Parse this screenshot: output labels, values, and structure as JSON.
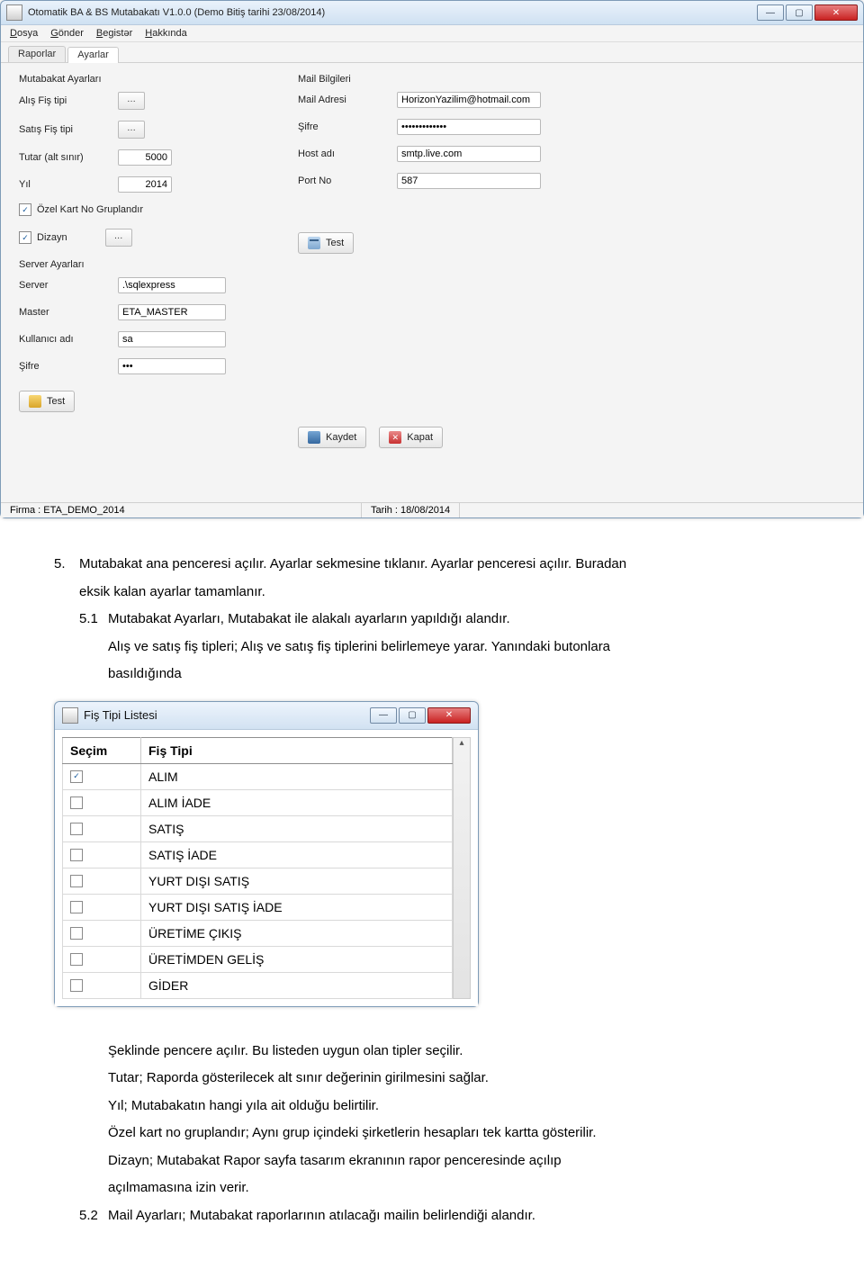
{
  "main_window": {
    "title": "Otomatik BA & BS Mutabakatı V1.0.0 (Demo Bitiş tarihi 23/08/2014)",
    "menu": {
      "dosya": "Dosya",
      "gonder": "Gönder",
      "begistir": "Begistər",
      "hakkinda": "Hakkında"
    },
    "tabs": {
      "raporlar": "Raporlar",
      "ayarlar": "Ayarlar"
    },
    "left": {
      "section": "Mutabakat Ayarları",
      "alis_fis_tipi": "Alış Fiş tipi",
      "satis_fis_tipi": "Satış Fiş tipi",
      "tutar_label": "Tutar (alt sınır)",
      "tutar_value": "5000",
      "yil_label": "Yıl",
      "yil_value": "2014",
      "ozel_kart": "Özel Kart No Gruplandır",
      "dizayn": "Dizayn",
      "server_section": "Server Ayarları",
      "server_label": "Server",
      "server_value": ".\\sqlexpress",
      "master_label": "Master",
      "master_value": "ETA_MASTER",
      "kullanici_label": "Kullanıcı adı",
      "kullanici_value": "sa",
      "sifre_label": "Şifre",
      "sifre_value": "•••",
      "test_btn": "Test"
    },
    "right": {
      "section": "Mail Bilgileri",
      "mail_label": "Mail Adresi",
      "mail_value": "HorizonYazilim@hotmail.com",
      "sifre_label": "Şifre",
      "sifre_value": "•••••••••••••",
      "host_label": "Host adı",
      "host_value": "smtp.live.com",
      "port_label": "Port No",
      "port_value": "587",
      "test_btn": "Test",
      "kaydet_btn": "Kaydet",
      "kapat_btn": "Kapat"
    },
    "status": {
      "firma": "Firma : ETA_DEMO_2014",
      "tarih": "Tarih : 18/08/2014"
    }
  },
  "para5": {
    "num": "5.",
    "line1": "Mutabakat ana penceresi açılır. Ayarlar sekmesine tıklanır. Ayarlar penceresi açılır. Buradan",
    "line2": "eksik kalan ayarlar tamamlanır.",
    "sub1_num": "5.1",
    "sub1_line1": "Mutabakat Ayarları, Mutabakat ile alakalı ayarların yapıldığı alandır.",
    "sub1_line2": "Alış ve satış fiş tipleri; Alış ve satış fiş tiplerini belirlemeye yarar. Yanındaki butonlara",
    "sub1_line3": "basıldığında"
  },
  "dialog": {
    "title": "Fiş Tipi Listesi",
    "col_secim": "Seçim",
    "col_fistipi": "Fiş Tipi",
    "rows": [
      {
        "checked": true,
        "name": "ALIM"
      },
      {
        "checked": false,
        "name": "ALIM İADE"
      },
      {
        "checked": false,
        "name": "SATIŞ"
      },
      {
        "checked": false,
        "name": "SATIŞ İADE"
      },
      {
        "checked": false,
        "name": "YURT DIŞI SATIŞ"
      },
      {
        "checked": false,
        "name": "YURT DIŞI SATIŞ İADE"
      },
      {
        "checked": false,
        "name": "ÜRETİME ÇIKIŞ"
      },
      {
        "checked": false,
        "name": "ÜRETİMDEN GELİŞ"
      },
      {
        "checked": false,
        "name": "GİDER"
      }
    ]
  },
  "after": {
    "l1": "Şeklinde pencere açılır. Bu listeden uygun olan tipler seçilir.",
    "l2": "Tutar; Raporda gösterilecek alt sınır değerinin girilmesini sağlar.",
    "l3": "Yıl; Mutabakatın hangi yıla ait olduğu belirtilir.",
    "l4": "Özel kart no gruplandır; Aynı grup içindeki şirketlerin hesapları tek kartta gösterilir.",
    "l5": "Dizayn; Mutabakat Rapor sayfa tasarım ekranının rapor penceresinde  açılıp",
    "l6": "açılmamasına izin  verir.",
    "sub2_num": "5.2",
    "sub2_text": "Mail Ayarları; Mutabakat raporlarının atılacağı mailin belirlendiği alandır."
  }
}
